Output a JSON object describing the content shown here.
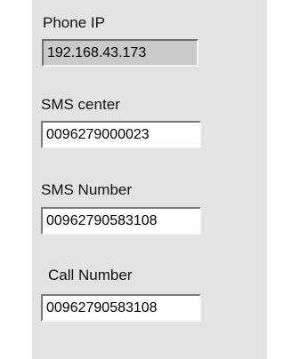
{
  "phone_ip": {
    "label": "Phone IP",
    "value": "192.168.43.173"
  },
  "sms_center": {
    "label": "SMS center",
    "value": "0096279000023"
  },
  "sms_number": {
    "label": "SMS Number",
    "value": "00962790583108"
  },
  "call_number": {
    "label": "Call Number",
    "value": "00962790583108"
  },
  "colors": {
    "panel_background": "#e3e3e3",
    "indicator_background": "#c9c9c9",
    "control_background": "#ffffff"
  }
}
